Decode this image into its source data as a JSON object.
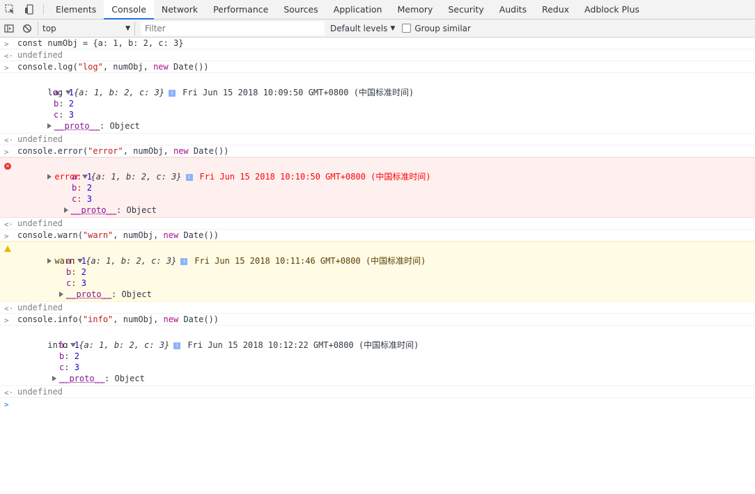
{
  "tabs": [
    "Elements",
    "Console",
    "Network",
    "Performance",
    "Sources",
    "Application",
    "Memory",
    "Security",
    "Audits",
    "Redux",
    "Adblock Plus"
  ],
  "toolbar": {
    "context": "top",
    "filter_placeholder": "Filter",
    "levels": "Default levels",
    "group_similar": "Group similar"
  },
  "entries": {
    "cmd1": "const numObj = {a: 1, b: 2, c: 3}",
    "res1": "undefined",
    "cmd2_pre": "console.log(",
    "cmd2_str": "\"log\"",
    "cmd2_mid": ", numObj, ",
    "cmd2_kw": "new",
    "cmd2_post": " Date())",
    "log_label": "log",
    "log_obj": "{a: 1, b: 2, c: 3}",
    "log_date": "Fri Jun 15 2018 10:09:50 GMT+0800 (中国标准时间)",
    "res2": "undefined",
    "cmd3_pre": "console.error(",
    "cmd3_str": "\"error\"",
    "cmd3_mid": ", numObj, ",
    "cmd3_kw": "new",
    "cmd3_post": " Date())",
    "error_label": "error",
    "error_obj": "{a: 1, b: 2, c: 3}",
    "error_date": "Fri Jun 15 2018 10:10:50 GMT+0800 (中国标准时间)",
    "res3": "undefined",
    "cmd4_pre": "console.warn(",
    "cmd4_str": "\"warn\"",
    "cmd4_mid": ", numObj, ",
    "cmd4_kw": "new",
    "cmd4_post": " Date())",
    "warn_label": "warn",
    "warn_obj": "{a: 1, b: 2, c: 3}",
    "warn_date": "Fri Jun 15 2018 10:11:46 GMT+0800 (中国标准时间)",
    "res4": "undefined",
    "cmd5_pre": "console.info(",
    "cmd5_str": "\"info\"",
    "cmd5_mid": ", numObj, ",
    "cmd5_kw": "new",
    "cmd5_post": " Date())",
    "info_label": "info",
    "info_obj": "{a: 1, b: 2, c: 3}",
    "info_date": "Fri Jun 15 2018 10:12:22 GMT+0800 (中国标准时间)",
    "res5": "undefined"
  },
  "props": {
    "a_key": "a",
    "a_val": "1",
    "b_key": "b",
    "b_val": "2",
    "c_key": "c",
    "c_val": "3",
    "proto_key": "__proto__",
    "proto_val": "Object"
  },
  "colors": {
    "accent": "#1a73e8",
    "error_bg": "#fff0f0",
    "warning_bg": "#fffbe5",
    "string": "#c41a16",
    "keyword": "#aa0d91",
    "property": "#881391",
    "number": "#1c00cf"
  }
}
